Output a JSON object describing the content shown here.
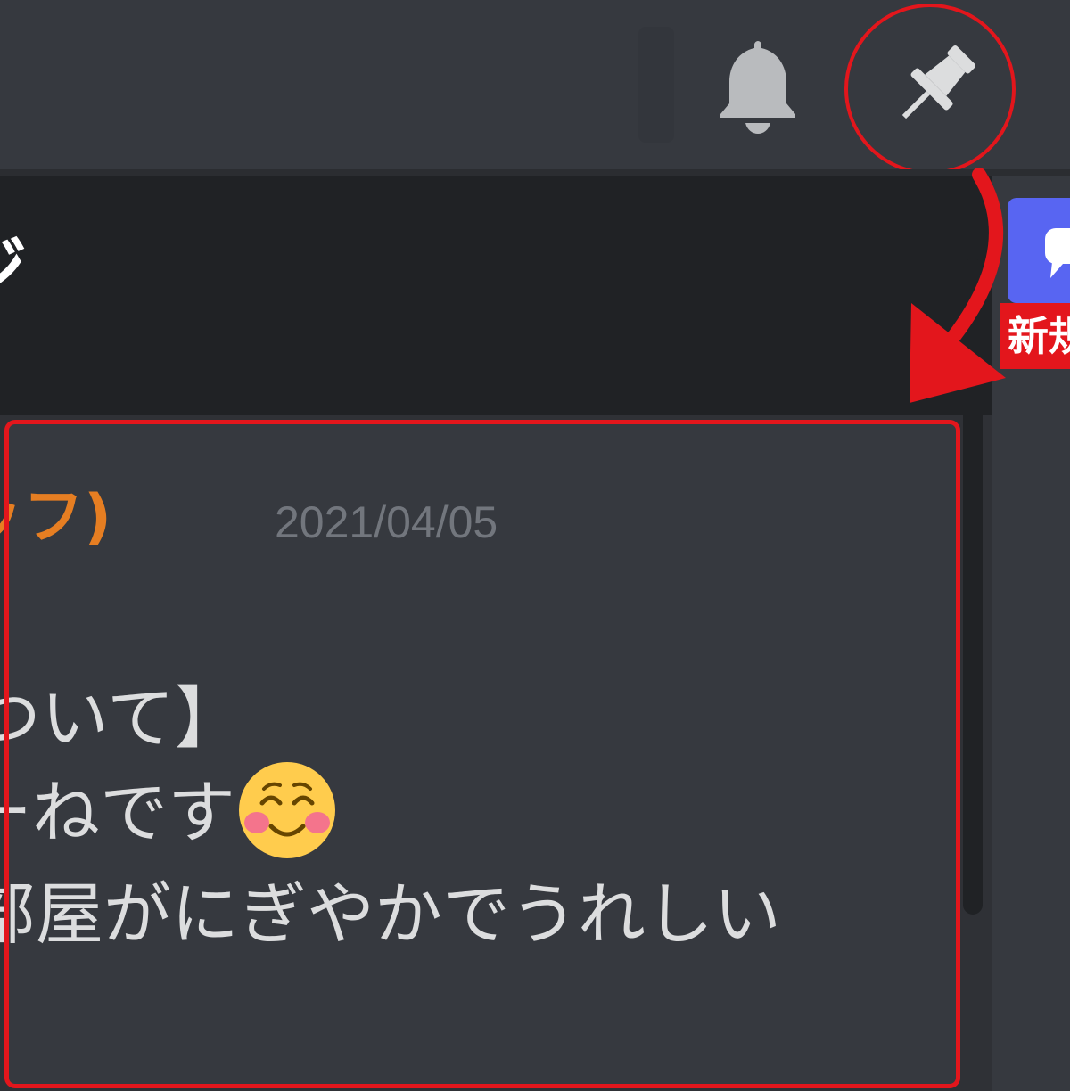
{
  "header": {
    "bell_icon": "bell-icon",
    "pin_icon": "pin-icon"
  },
  "popout": {
    "title": "ジ"
  },
  "message": {
    "author": "ッフ)",
    "timestamp": "2021/04/05",
    "lines": [
      "ついて】",
      "ーねです",
      "部屋がにぎやかでうれしい"
    ],
    "emoji": "smiling-face-with-blush"
  },
  "side": {
    "badge_label": "新規",
    "chat_icon": "chat-bubble-icon"
  },
  "colors": {
    "annotation": "#e3161c",
    "author": "#e67e22",
    "blurple": "#5865f2",
    "background": "#36393f",
    "header": "#202225"
  }
}
